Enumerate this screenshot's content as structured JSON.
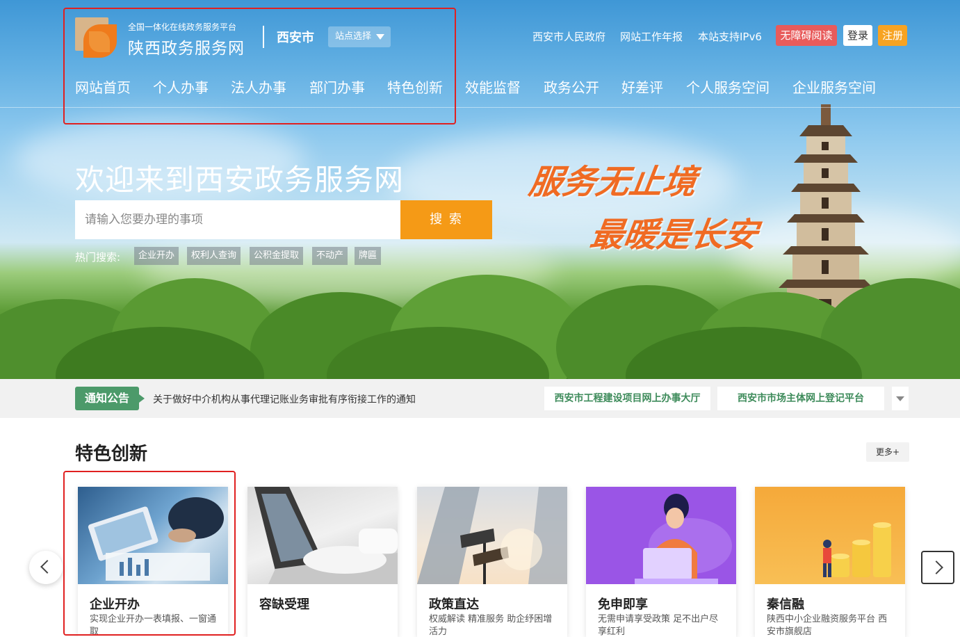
{
  "header": {
    "platform_subtitle": "全国一体化在线政务服务平台",
    "platform_title": "陕西政务服务网",
    "city": "西安市",
    "site_select": "站点选择",
    "links": [
      "西安市人民政府",
      "网站工作年报",
      "本站支持IPv6"
    ],
    "accessibility": "无障碍阅读",
    "login": "登录",
    "register": "注册"
  },
  "nav": [
    "网站首页",
    "个人办事",
    "法人办事",
    "部门办事",
    "特色创新",
    "效能监督",
    "政务公开",
    "好差评",
    "个人服务空间",
    "企业服务空间"
  ],
  "hero": {
    "welcome": "欢迎来到西安政务服务网",
    "search_placeholder": "请输入您要办理的事项",
    "search_button": "搜 索",
    "hot_label": "热门搜索:",
    "hot_tags": [
      "企业开办",
      "权利人查询",
      "公积金提取",
      "不动产",
      "牌匾"
    ],
    "slogan_line1": "服务无止境",
    "slogan_line2": "最暖是长安"
  },
  "notice": {
    "tag": "通知公告",
    "text": "关于做好中介机构从事代理记账业务审批有序衔接工作的通知",
    "platforms": [
      "西安市工程建设项目网上办事大厅",
      "西安市市场主体网上登记平台"
    ]
  },
  "featured": {
    "title": "特色创新",
    "more": "更多+",
    "cards": [
      {
        "title": "企业开办",
        "desc": "实现企业开办一表填报、一窗通取"
      },
      {
        "title": "容缺受理",
        "desc": ""
      },
      {
        "title": "政策直达",
        "desc": "权威解读 精准服务 助企纾困增活力"
      },
      {
        "title": "免申即享",
        "desc": "无需申请享受政策 足不出户尽享红利"
      },
      {
        "title": "秦信融",
        "desc": "陕西中小企业融资服务平台 西安市旗舰店"
      }
    ]
  },
  "colors": {
    "accent_orange": "#f59a16",
    "notice_green": "#4c9a6a",
    "accessibility_red": "#e85b5b",
    "highlight_red": "#e02020"
  }
}
